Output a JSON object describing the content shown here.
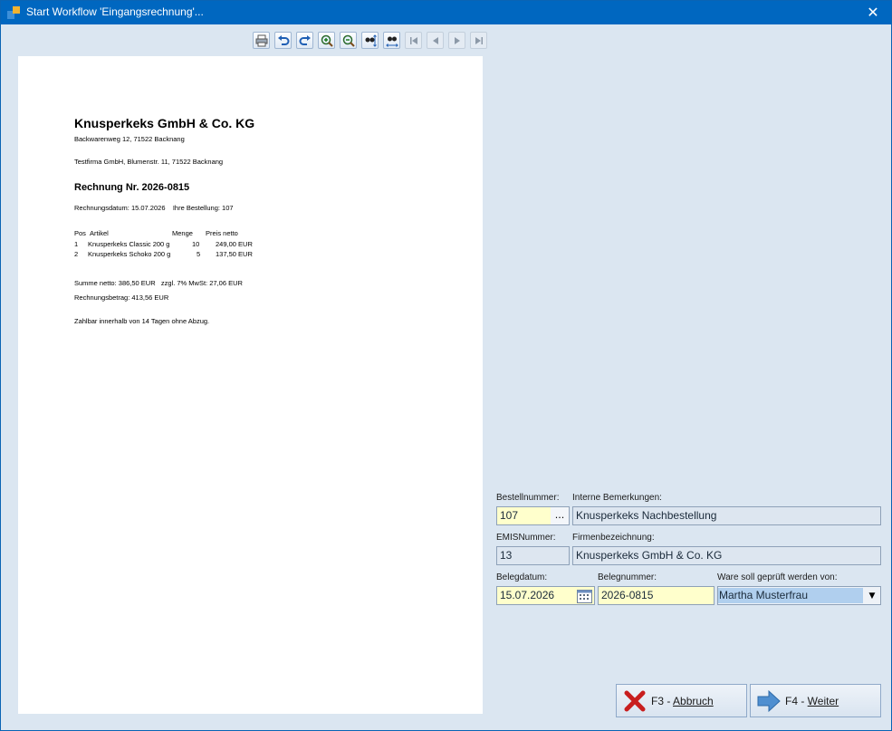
{
  "window": {
    "title": "Start Workflow 'Eingangsrechnung'..."
  },
  "toolbar": {
    "buttons": [
      "print-icon",
      "undo-icon",
      "redo-icon",
      "zoom-in-icon",
      "zoom-out-icon",
      "fit-height-icon",
      "fit-width-icon",
      "first-page-icon",
      "previous-page-icon",
      "next-page-icon",
      "last-page-icon"
    ]
  },
  "document": {
    "company": "Knusperkeks GmbH & Co. KG",
    "address": "Backwarenweg 12, 71522 Backnang",
    "recipient": "Testfirma GmbH, Blumenstr. 11, 71522 Backnang",
    "heading": "Rechnung Nr. 2026-0815",
    "meta": "Rechnungsdatum: 15.07.2026    Ihre Bestellung: 107",
    "table_header": {
      "pos": "Pos",
      "article": "Artikel",
      "qty": "Menge",
      "price": "Preis netto"
    },
    "rows": [
      {
        "pos": "1",
        "article": "Knusperkeks Classic 200 g",
        "qty": "10",
        "price": "249,00 EUR"
      },
      {
        "pos": "2",
        "article": "Knusperkeks Schoko 200 g",
        "qty": "5",
        "price": "137,50 EUR"
      }
    ],
    "sum": "Summe netto: 386,50 EUR   zzgl. 7% MwSt: 27,06 EUR",
    "total": "Rechnungsbetrag: 413,56 EUR",
    "terms": "Zahlbar innerhalb von 14 Tagen ohne Abzug."
  },
  "form": {
    "bestellnummer_label": "Bestellnummer:",
    "bestellnummer_value": "107",
    "ellipsis": "...",
    "bemerkungen_label": "Interne Bemerkungen:",
    "bemerkungen_value": "Knusperkeks Nachbestellung",
    "emis_label": "EMISNummer:",
    "emis_value": "13",
    "firma_label": "Firmenbezeichnung:",
    "firma_value": "Knusperkeks GmbH & Co. KG",
    "belegdatum_label": "Belegdatum:",
    "belegdatum_value": "15.07.2026",
    "belegnummer_label": "Belegnummer:",
    "belegnummer_value": "2026-0815",
    "pruefer_label": "Ware soll geprüft werden von:",
    "pruefer_value": "Martha Musterfrau"
  },
  "buttons": {
    "cancel_key": "F3 - ",
    "cancel_label": "Abbruch",
    "next_key": "F4 - ",
    "next_label": "Weiter"
  },
  "colors": {
    "titlebar": "#0067c0",
    "window_bg": "#dbe6f1",
    "field_highlight": "#ffffcc",
    "selection": "#b0cfee"
  }
}
